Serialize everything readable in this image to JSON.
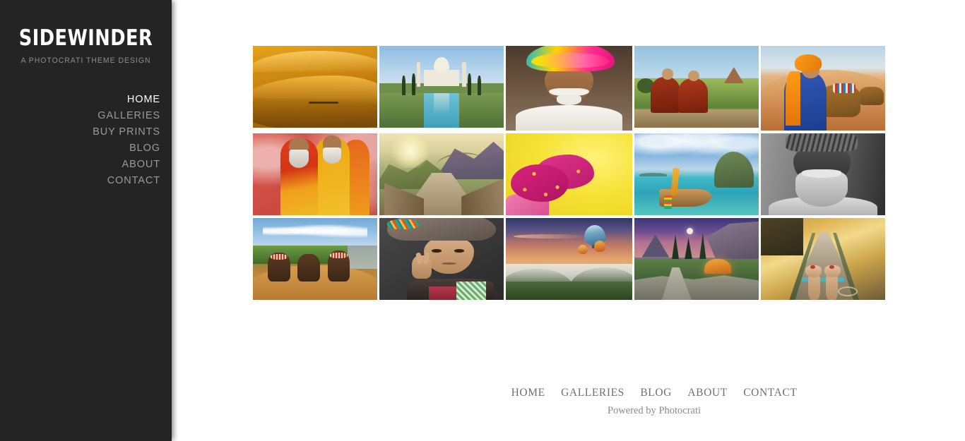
{
  "site": {
    "title": "SIDEWINDER",
    "tagline": "A PHOTOCRATI THEME DESIGN"
  },
  "sidebar": {
    "nav": [
      {
        "label": "HOME",
        "active": true
      },
      {
        "label": "GALLERIES",
        "active": false
      },
      {
        "label": "BUY PRINTS",
        "active": false
      },
      {
        "label": "BLOG",
        "active": false
      },
      {
        "label": "ABOUT",
        "active": false
      },
      {
        "label": "CONTACT",
        "active": false
      }
    ],
    "background_color": "#242424",
    "active_color": "#ffffff",
    "link_color": "#9a9a9a"
  },
  "gallery": {
    "rows": [
      {
        "items": [
          {
            "alt": "Golden sand dunes of the desert with a distant camel caravan"
          },
          {
            "alt": "The Taj Mahal reflected in its long water pool at Agra"
          },
          {
            "alt": "Smiling Rajasthani man in a multicolored turban with white moustache"
          },
          {
            "alt": "Two young Buddhist monks in red robes looking over the temples of Bagan"
          },
          {
            "alt": "Boy in orange and blue robes resting beside camels on desert sand"
          }
        ]
      },
      {
        "items": [
          {
            "alt": "Three sadhus in red and saffron robes seated against a red wall"
          },
          {
            "alt": "The Great Wall of China winding through misty hills at sunrise"
          },
          {
            "alt": "Hands covered in pink and yellow Holi powder"
          },
          {
            "alt": "Thai longtail boat on turquoise water beside a limestone rock island"
          },
          {
            "alt": "Black and white portrait of an elderly bearded man wearing a turban"
          }
        ]
      },
      {
        "items": [
          {
            "alt": "Three painted tribal children sitting on an ochre riverbank"
          },
          {
            "alt": "Young girl in traditional headdress making a peace sign"
          },
          {
            "alt": "Hot air balloons floating over misty hills at sunrise"
          },
          {
            "alt": "Orange tent camping in an alpine meadow at twilight with a crescent moon"
          },
          {
            "alt": "First person view of feet in a wooden boat on sunlit water"
          }
        ]
      }
    ]
  },
  "footer": {
    "nav": [
      {
        "label": "HOME"
      },
      {
        "label": "GALLERIES"
      },
      {
        "label": "BLOG"
      },
      {
        "label": "ABOUT"
      },
      {
        "label": "CONTACT"
      }
    ],
    "credit_prefix": "Powered by",
    "credit_brand": "Photocrati",
    "text_color": "#6f6f6f"
  }
}
